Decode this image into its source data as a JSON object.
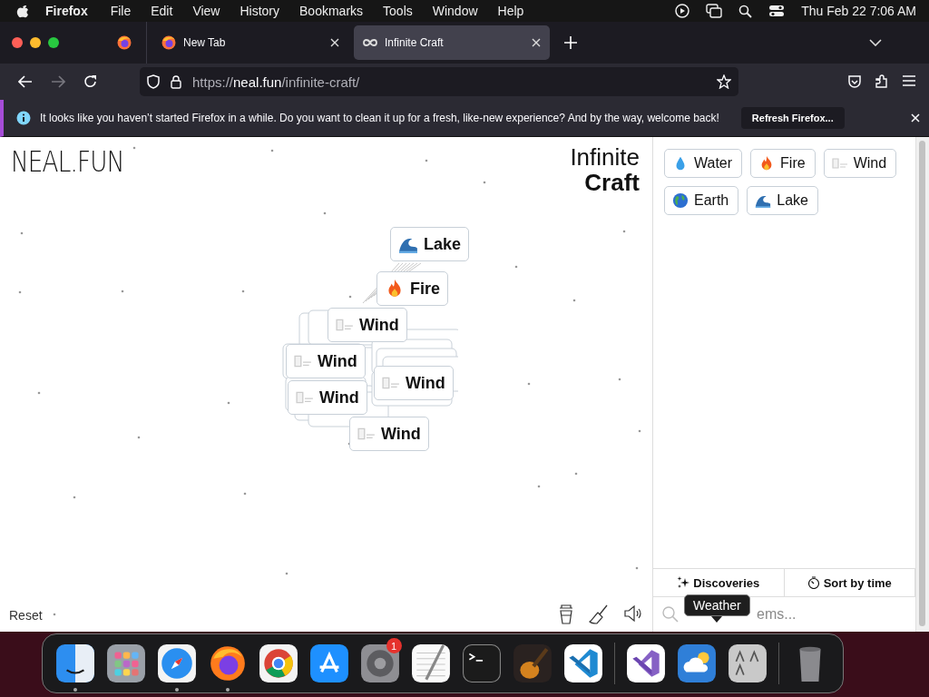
{
  "menu_bar": {
    "app": "Firefox",
    "items": [
      "File",
      "Edit",
      "View",
      "History",
      "Bookmarks",
      "Tools",
      "Window",
      "Help"
    ],
    "clock": "Thu Feb 22  7:06 AM"
  },
  "tabs": [
    {
      "title": "New Tab",
      "selected": false
    },
    {
      "title": "Infinite Craft",
      "selected": true
    }
  ],
  "address_bar": {
    "scheme": "https://",
    "host": "neal.fun",
    "path": "/infinite-craft/"
  },
  "notification": {
    "message": "It looks like you haven’t started Firefox in a while. Do you want to clean it up for a fresh, like-new experience? And by the way, welcome back!",
    "button": "Refresh Firefox..."
  },
  "page": {
    "logo": "NEAL.FUN",
    "title_lines": [
      "Infinite",
      "Craft"
    ],
    "canvas_items": [
      {
        "label": "Lake",
        "kind": "lake"
      },
      {
        "label": "Fire",
        "kind": "fire"
      },
      {
        "label": "Wind",
        "kind": "wind"
      },
      {
        "label": "Wind",
        "kind": "wind"
      },
      {
        "label": "Wind",
        "kind": "wind"
      },
      {
        "label": "Wind",
        "kind": "wind"
      },
      {
        "label": "Wind",
        "kind": "wind"
      }
    ],
    "reset": "Reset",
    "sidebar": {
      "items": [
        {
          "label": "Water",
          "kind": "water"
        },
        {
          "label": "Fire",
          "kind": "fire"
        },
        {
          "label": "Wind",
          "kind": "wind"
        },
        {
          "label": "Earth",
          "kind": "earth"
        },
        {
          "label": "Lake",
          "kind": "lake"
        }
      ],
      "discoveries": "Discoveries",
      "sort": "Sort by time",
      "search_placeholder": "ems..."
    }
  },
  "dock": {
    "tooltip": "Weather",
    "apps": [
      {
        "kind": "finder",
        "running": true
      },
      {
        "kind": "launchpad",
        "running": false
      },
      {
        "kind": "safari",
        "running": true
      },
      {
        "kind": "firefox",
        "running": true
      },
      {
        "kind": "chrome",
        "running": false
      },
      {
        "kind": "appstore",
        "running": false
      },
      {
        "kind": "settings",
        "running": false,
        "badge": "1"
      },
      {
        "kind": "textedit",
        "running": false
      },
      {
        "kind": "terminal",
        "running": false
      },
      {
        "kind": "garageband",
        "running": false
      },
      {
        "kind": "vscode",
        "running": false
      },
      {
        "kind": "divider"
      },
      {
        "kind": "visualstudio",
        "running": false
      },
      {
        "kind": "weather",
        "running": false
      },
      {
        "kind": "dictionary",
        "running": false
      },
      {
        "kind": "divider"
      },
      {
        "kind": "trash",
        "running": false
      }
    ]
  }
}
